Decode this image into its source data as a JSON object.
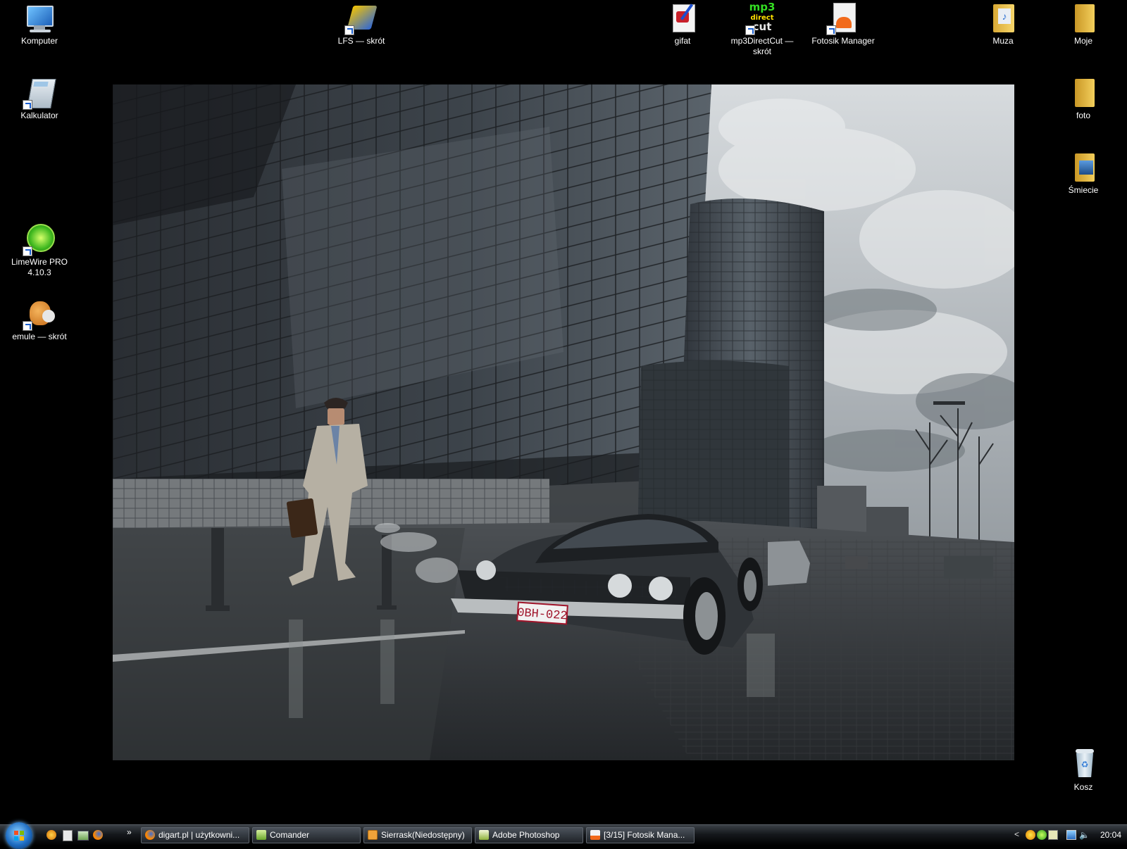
{
  "desktop": {
    "icons": [
      {
        "label": "Komputer",
        "icon": "computer-icon"
      },
      {
        "label": "LFS — skrót",
        "icon": "lfs-icon"
      },
      {
        "label": "gifat",
        "icon": "gifat-icon"
      },
      {
        "label": "mp3DirectCut — skrót",
        "icon": "mp3directcut-icon"
      },
      {
        "label": "Fotosik Manager",
        "icon": "fotosik-manager-icon"
      },
      {
        "label": "Muza",
        "icon": "music-folder-icon"
      },
      {
        "label": "Moje",
        "icon": "folder-icon"
      },
      {
        "label": "Kalkulator",
        "icon": "calculator-icon"
      },
      {
        "label": "foto",
        "icon": "folder-icon"
      },
      {
        "label": "Śmiecie",
        "icon": "picture-folder-icon"
      },
      {
        "label": "LimeWire PRO 4.10.3",
        "icon": "limewire-icon"
      },
      {
        "label": "emule — skrót",
        "icon": "emule-icon"
      },
      {
        "label": "Kosz",
        "icon": "recycle-bin-icon"
      }
    ],
    "wallpaper": {
      "plate": "0BH-022"
    }
  },
  "taskbar": {
    "quicklaunch_more": "»",
    "buttons": [
      {
        "label": "digart.pl | użytkowni...",
        "icon": "firefox-icon"
      },
      {
        "label": "Comander",
        "icon": "commander-icon"
      },
      {
        "label": "Sierrask(Niedostępny)",
        "icon": "mail-icon"
      },
      {
        "label": "Adobe Photoshop",
        "icon": "photoshop-icon"
      },
      {
        "label": "[3/15] Fotosik Mana...",
        "icon": "fotosik-icon"
      }
    ],
    "tray_chevron": "<",
    "clock": "20:04"
  }
}
